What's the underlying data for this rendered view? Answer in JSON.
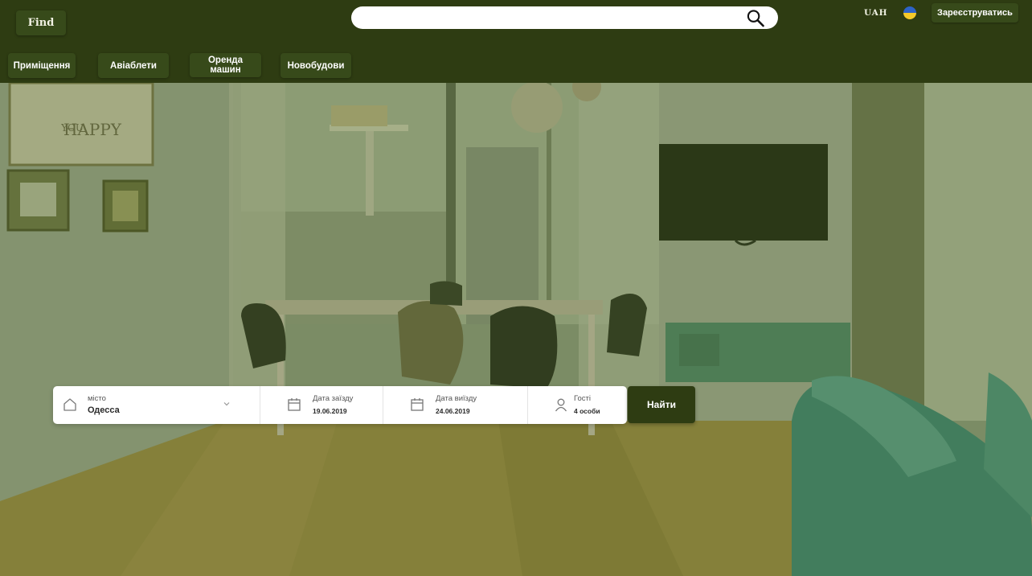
{
  "header": {
    "logo": "Find",
    "search_placeholder": "",
    "currency": "UAH",
    "register_label": "Зареєструватись"
  },
  "nav": {
    "items": [
      "Приміщення",
      "Авіаблети",
      "Оренда машин",
      "Новобудови"
    ]
  },
  "hero": {
    "sign_text": "HAPPY",
    "sign_text_2": "YOU"
  },
  "booking": {
    "city_label": "місто",
    "city_value": "Одесса",
    "checkin_label": "Дата заїзду",
    "checkin_value": "19.06.2019",
    "checkout_label": "Дата виїзду",
    "checkout_value": "24.06.2019",
    "guests_label": "Гості",
    "guests_value": "4 особи",
    "submit_label": "Найти"
  },
  "colors": {
    "header_bg": "#2e3c12",
    "button_bg": "#374a1a",
    "overlay": "#5a6b2a"
  },
  "icons": [
    "search-icon",
    "flag-ukraine-icon",
    "home-icon",
    "chevron-down-icon",
    "calendar-icon",
    "user-icon"
  ]
}
